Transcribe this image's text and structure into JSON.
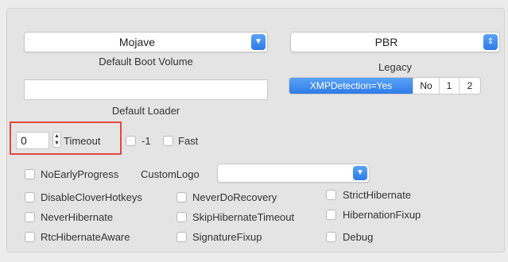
{
  "boot_volume": {
    "value": "Mojave",
    "caption": "Default Boot Volume"
  },
  "legacy": {
    "value": "PBR",
    "caption": "Legacy"
  },
  "xmp": {
    "options": [
      "XMPDetection=Yes",
      "No",
      "1",
      "2"
    ],
    "selected": "XMPDetection=Yes"
  },
  "default_loader": {
    "value": "",
    "caption": "Default Loader"
  },
  "timeout": {
    "value": "0",
    "label": "Timeout"
  },
  "flags": {
    "minus_one": "-1",
    "fast": "Fast"
  },
  "no_early_progress": "NoEarlyProgress",
  "custom_logo": {
    "label": "CustomLogo",
    "value": ""
  },
  "options": {
    "disable_clover_hotkeys": "DisableCloverHotkeys",
    "never_do_recovery": "NeverDoRecovery",
    "strict_hibernate": "StrictHibernate",
    "never_hibernate": "NeverHibernate",
    "skip_hibernate_timeout": "SkipHibernateTimeout",
    "hibernation_fixup": "HibernationFixup",
    "rtc_hibernate_aware": "RtcHibernateAware",
    "signature_fixup": "SignatureFixup",
    "debug": "Debug"
  },
  "highlight_color": "#e2483c",
  "accent_color": "#2f7be8"
}
